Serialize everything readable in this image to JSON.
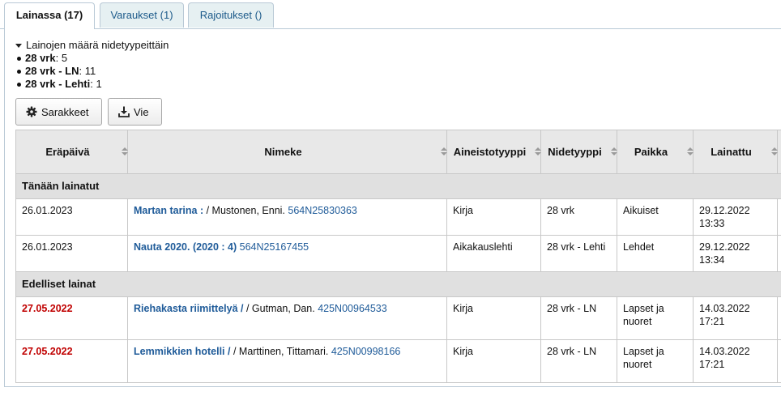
{
  "tabs": [
    {
      "label": "Lainassa (17)"
    },
    {
      "label": "Varaukset (1)"
    },
    {
      "label": "Rajoitukset ()"
    }
  ],
  "summary": {
    "heading": "Lainojen määrä nidetyypeittäin",
    "items": [
      {
        "type": "28 vrk",
        "count": "5"
      },
      {
        "type": "28 vrk - LN",
        "count": "11"
      },
      {
        "type": "28 vrk - Lehti",
        "count": "1"
      }
    ]
  },
  "toolbar": {
    "columns_label": "Sarakkeet",
    "export_label": "Vie"
  },
  "table": {
    "headers": [
      "Eräpäivä",
      "Nimeke",
      "Aineistotyyppi",
      "Nidetyyppi",
      "Paikka",
      "Lainattu"
    ],
    "groups": [
      {
        "label": "Tänään lainatut",
        "rows": [
          {
            "due": "26.01.2023",
            "title": "Martan tarina :",
            "author": " / Mustonen, Enni.",
            "barcode": "564N25830363",
            "material": "Kirja",
            "itemtype": "28 vrk",
            "location": "Aikuiset",
            "checkout_date": "29.12.2022",
            "checkout_time": "13:33"
          },
          {
            "due": "26.01.2023",
            "title": "Nauta 2020. (2020 : 4)",
            "author": "",
            "barcode": "564N25167455",
            "material": "Aikakauslehti",
            "itemtype": "28 vrk - Lehti",
            "location": "Lehdet",
            "checkout_date": "29.12.2022",
            "checkout_time": "13:34"
          }
        ]
      },
      {
        "label": "Edelliset lainat",
        "rows": [
          {
            "due": "27.05.2022",
            "title": "Riehakasta riimittelyä /",
            "author": " / Gutman, Dan.",
            "barcode": "425N00964533",
            "material": "Kirja",
            "itemtype": "28 vrk - LN",
            "location_line1": "Lapset ja",
            "location_line2": "nuoret",
            "checkout_date": "14.03.2022",
            "checkout_time": "17:21"
          },
          {
            "due": "27.05.2022",
            "title": "Lemmikkien hotelli /",
            "author": " / Marttinen, Tittamari.",
            "barcode": "425N00998166",
            "material": "Kirja",
            "itemtype": "28 vrk - LN",
            "location_line1": "Lapset ja",
            "location_line2": "nuoret",
            "checkout_date": "14.03.2022",
            "checkout_time": "17:21"
          }
        ]
      }
    ]
  },
  "colors": {
    "link": "#1f5b99",
    "overdue": "#c00000",
    "tab_bg": "#e6f0f2"
  }
}
